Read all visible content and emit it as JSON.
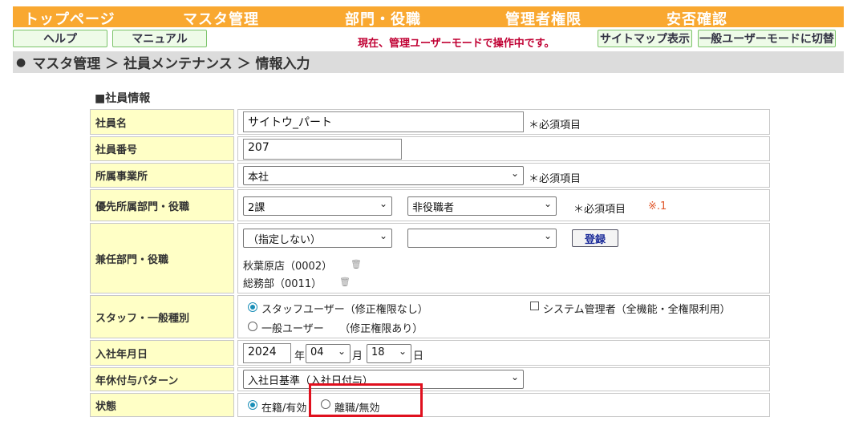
{
  "nav": {
    "items": [
      "トップページ",
      "マスタ管理",
      "部門・役職",
      "管理者権限",
      "安否確認"
    ]
  },
  "toolbar": {
    "help": "ヘルプ",
    "manual": "マニュアル",
    "mode_text": "現在、管理ユーザーモードで操作中です。",
    "sitemap": "サイトマップ表示",
    "switch_mode": "一般ユーザーモードに切替"
  },
  "breadcrumb": "マスタ管理 ＞ 社員メンテナンス ＞ 情報入力",
  "section_title": "■社員情報",
  "form": {
    "employee_name": {
      "label": "社員名",
      "value": "サイトウ_パート",
      "required": "＊必須項目"
    },
    "employee_number": {
      "label": "社員番号",
      "value": "207"
    },
    "office": {
      "label": "所属事業所",
      "value": "本社",
      "required": "＊必須項目"
    },
    "primary_dept": {
      "label": "優先所属部門・役職",
      "dept": "2課",
      "position": "非役職者",
      "required": "＊必須項目",
      "note": "※.1"
    },
    "concurrent": {
      "label": "兼任部門・役職",
      "dept": "（指定しない）",
      "position": "",
      "register": "登録",
      "entries": [
        "秋葉原店（0002）",
        "総務部（0011）"
      ]
    },
    "staff_type": {
      "label": "スタッフ・一般種別",
      "staff": "スタッフユーザー（修正権限なし）",
      "general": "一般ユーザー　　（修正権限あり）",
      "sysadmin": "システム管理者（全機能・全権限利用）"
    },
    "hire_date": {
      "label": "入社年月日",
      "year": "2024",
      "year_unit": "年",
      "month": "04",
      "month_unit": "月",
      "day": "18",
      "day_unit": "日"
    },
    "leave_pattern": {
      "label": "年休付与パターン",
      "value": "入社日基準（入社日付与）"
    },
    "status": {
      "label": "状態",
      "active": "在籍/有効",
      "retired": "離職/無効"
    }
  },
  "colors": {
    "nav": "#f9a830",
    "label_bg": "#ffffc6",
    "highlight": "#e0101e",
    "mode_text": "#c00033"
  }
}
